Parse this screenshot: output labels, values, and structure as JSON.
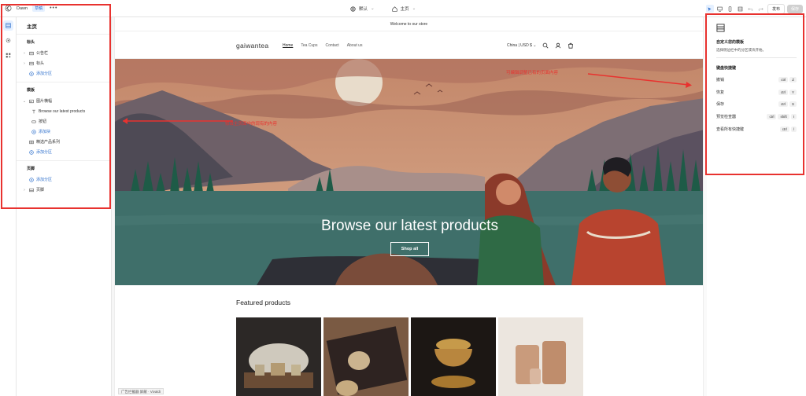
{
  "topbar": {
    "theme_name": "Dawn",
    "theme_badge": "草稿",
    "more": "•••",
    "center": {
      "variant_label": "默认",
      "page_label": "主页"
    },
    "publish_label": "发布",
    "save_label": "保存"
  },
  "left_panel": {
    "title": "主页",
    "groups": [
      {
        "title": "标头",
        "items": [
          {
            "label": "公告栏",
            "kind": "section"
          },
          {
            "label": "标头",
            "kind": "section"
          },
          {
            "label": "添加分区",
            "kind": "add"
          }
        ]
      },
      {
        "title": "模板",
        "items": [
          {
            "label": "图片横幅",
            "kind": "section-open"
          },
          {
            "label": "Browse our latest products",
            "kind": "block"
          },
          {
            "label": "按钮",
            "kind": "block"
          },
          {
            "label": "添加块",
            "kind": "add-block"
          },
          {
            "label": "精选产品系列",
            "kind": "section"
          },
          {
            "label": "添加分区",
            "kind": "add"
          }
        ]
      },
      {
        "title": "页脚",
        "items": [
          {
            "label": "添加分区",
            "kind": "add"
          },
          {
            "label": "页脚",
            "kind": "section"
          }
        ]
      }
    ]
  },
  "preview": {
    "announcement": "Welcome to our store",
    "logo": "gaiwantea",
    "nav": [
      "Home",
      "Tea Cups",
      "Contact",
      "About us"
    ],
    "country": "China | USD $",
    "hero_title": "Browse our latest products",
    "hero_button": "Shop all",
    "featured_title": "Featured products"
  },
  "right_panel": {
    "title": "自定义您的模板",
    "subtitle": "选择侧边栏中的分区或块开始。",
    "shortcuts_title": "键盘快捷键",
    "shortcuts": [
      {
        "label": "撤销",
        "keys": [
          "ctrl",
          "Z"
        ]
      },
      {
        "label": "恢复",
        "keys": [
          "ctrl",
          "Y"
        ]
      },
      {
        "label": "保存",
        "keys": [
          "ctrl",
          "S"
        ]
      },
      {
        "label": "预览检查器",
        "keys": [
          "ctrl",
          "shift",
          "I"
        ]
      },
      {
        "label": "查看所有快捷键",
        "keys": [
          "ctrl",
          "/"
        ]
      }
    ]
  },
  "annotations": {
    "left_note": "修改主页面中的现有的内容",
    "right_note": "可编辑调整已有的页面内容"
  },
  "bottom_badge": "广告拦截器 屏蔽 · Vivaldi",
  "colors": {
    "accent": "#2c6ecb",
    "annotation_red": "#e8322f",
    "hero_sky": "#c08a6a",
    "lake": "#3f6f6a"
  }
}
